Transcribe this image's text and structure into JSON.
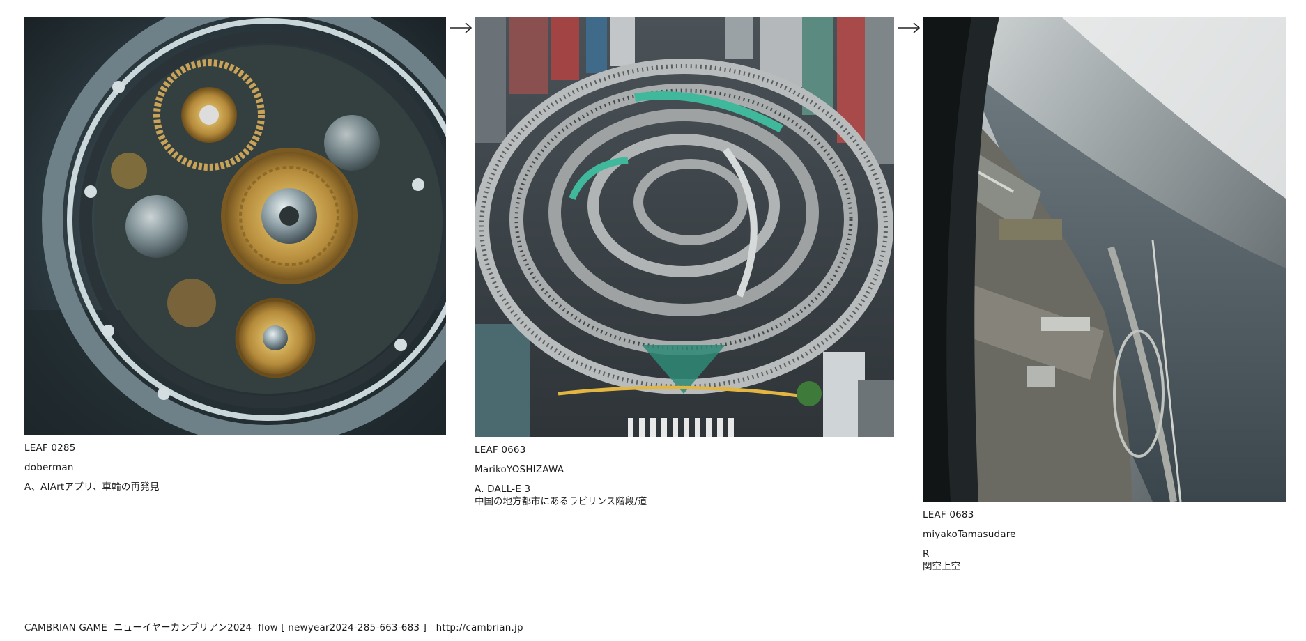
{
  "leaves": [
    {
      "id": "LEAF 0285",
      "author": "doberman",
      "note": "A、AIArtアプリ、車輪の再発見",
      "note_line2": ""
    },
    {
      "id": "LEAF 0663",
      "author": "MarikoYOSHIZAWA",
      "note": "A. DALL-E 3",
      "note_line2": "中国の地方都市にあるラビリンス階段/道"
    },
    {
      "id": "LEAF 0683",
      "author": "miyakoTamasudare",
      "note": "R",
      "note_line2": "関空上空"
    }
  ],
  "footer": {
    "text": "CAMBRIAN GAME  ニューイヤーカンブリアン2024  flow [ newyear2024-285-663-683 ]   ",
    "url": "http://cambrian.jp"
  },
  "icons": {
    "next": "right-arrow-icon"
  },
  "colors": {
    "background": "#ffffff",
    "text": "#1a1a1a"
  }
}
